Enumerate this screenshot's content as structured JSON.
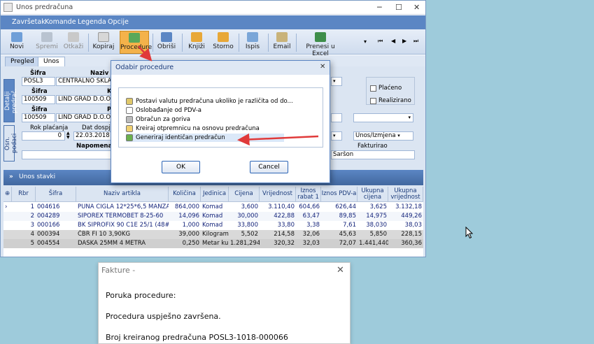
{
  "window": {
    "title": "Unos predračuna"
  },
  "menu": [
    "Završetak",
    "Komande",
    "Legenda",
    "Opcije"
  ],
  "toolbar": {
    "buttons": [
      {
        "label": "Novi",
        "icon": "new-document-icon",
        "enabled": true
      },
      {
        "label": "Spremi",
        "icon": "save-icon",
        "enabled": false
      },
      {
        "label": "Otkaži",
        "icon": "undo-icon",
        "enabled": false
      },
      {
        "label": "Kopiraj",
        "icon": "copy-icon",
        "enabled": true
      },
      {
        "label": "Procedure",
        "icon": "procedure-icon",
        "enabled": true,
        "active": true
      },
      {
        "label": "Obriši",
        "icon": "trash-icon",
        "enabled": true
      },
      {
        "label": "Knjiži",
        "icon": "book-icon",
        "enabled": true
      },
      {
        "label": "Storno",
        "icon": "storno-icon",
        "enabled": true
      },
      {
        "label": "Ispis",
        "icon": "print-icon",
        "enabled": true
      },
      {
        "label": "Email",
        "icon": "email-icon",
        "enabled": true
      },
      {
        "label": "Prenesi u Excel",
        "icon": "excel-icon",
        "enabled": true
      }
    ],
    "nav": [
      "⏮",
      "◀",
      "▶",
      "⏭"
    ]
  },
  "tabs": [
    "Pregled",
    "Unos"
  ],
  "side_tabs": [
    "Detalji predrač.",
    "Osn. podaci"
  ],
  "form": {
    "sifra_label": "Šifra",
    "naziv_label": "Naziv M",
    "sifra1": "POSL3",
    "naziv1": "CENTRALNO SKLADIS",
    "sifra2_label": "Šifra",
    "k_label": "K",
    "sifra2": "100509",
    "naziv2": "LIND GRAD D.O.O.",
    "sifra3_label": "Šifra",
    "p_label": "P",
    "sifra3": "100509",
    "naziv3": "LIND GRAD D.O.O.",
    "rok_label": "Rok plaćanja",
    "dat_label": "Dat dospje",
    "rok": "0",
    "datum": "22.03.2018",
    "napomena_label": "Napomena",
    "placeno_label": "Plaćeno",
    "realizirano_label": "Realizirano",
    "status": "Unos/Izmjena",
    "fakturirao_label": "Fakturirao",
    "fakturirao": "Saršon"
  },
  "stavke": {
    "title": "Unos stavki",
    "headers": [
      "Rbr",
      "Šifra",
      "Naziv artikla",
      "Količina",
      "Jedinica",
      "Cijena",
      "Vrijednost",
      "Iznos rabat 1",
      "Iznos PDV-a",
      "Ukupna cijena",
      "Ukupna vrijednost"
    ],
    "rows": [
      [
        "1",
        "004616",
        "PUNA CIGLA 12*25*6,5 MANZANO",
        "864,000",
        "Komad",
        "3,600",
        "3.110,40",
        "604,66",
        "626,44",
        "3,625",
        "3.132,18"
      ],
      [
        "2",
        "004289",
        "SIPOREX TERMOBET 8-25-60",
        "14,096",
        "Komad",
        "30,000",
        "422,88",
        "63,47",
        "89,85",
        "14,975",
        "449,26"
      ],
      [
        "3",
        "000166",
        "BK SIPROFIX 90 C1E 25/1 (48#)",
        "1,000",
        "Komad",
        "33,800",
        "33,80",
        "3,38",
        "7,61",
        "38,030",
        "38,03"
      ],
      [
        "4",
        "000394",
        "ČBR FI 10  3,90KG",
        "39,000",
        "Kilogram",
        "5,502",
        "214,58",
        "32,06",
        "45,63",
        "5,850",
        "228,15"
      ],
      [
        "5",
        "004554",
        "DASKA 25MM 4 METRA",
        "0,250",
        "Metar kul",
        "1.281,294",
        "320,32",
        "32,03",
        "72,07",
        "1.441,440",
        "360,36"
      ]
    ]
  },
  "dialog": {
    "title": "Odabir procedure",
    "items": [
      {
        "label": "Postavi valutu predračuna ukoliko je različita od do...",
        "icon": "currency-icon"
      },
      {
        "label": "Oslobađanje od PDV-a",
        "icon": "document-icon"
      },
      {
        "label": "Obračun za goriva",
        "icon": "calculator-icon"
      },
      {
        "label": "Kreiraj otpremnicu na osnovu predračuna",
        "icon": "pencil-icon"
      },
      {
        "label": "Generiraj identičan predračun",
        "icon": "generate-icon"
      }
    ],
    "ok": "OK",
    "cancel": "Cancel"
  },
  "message": {
    "title": "Fakture -",
    "line1": "Poruka procedure:",
    "line2": "Procedura uspješno završena.",
    "line3": "Broj kreiranog predračuna POSL3-1018-000066"
  },
  "colors": {
    "accent": "#5b86c4",
    "arrow": "#e03a3a",
    "active_button": "#f4b24a"
  }
}
